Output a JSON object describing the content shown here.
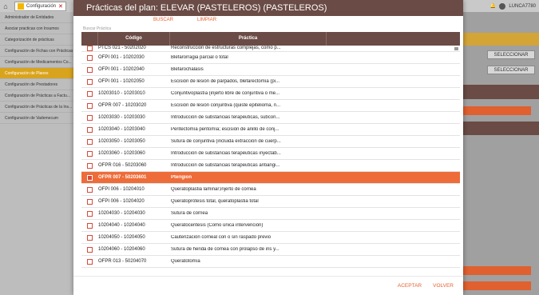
{
  "app": {
    "tab_label": "Configuración",
    "user_name": "LUNCA7780"
  },
  "sidebar": {
    "items": [
      {
        "label": "Administrador de Entidades",
        "active": false
      },
      {
        "label": "Asociar practicas con Insumos",
        "active": false
      },
      {
        "label": "Categorización de prácticas",
        "active": false
      },
      {
        "label": "Configuración de Fichas con Prácticas",
        "active": false
      },
      {
        "label": "Configuración de Medicamentos Co...",
        "active": false
      },
      {
        "label": "Configuración de Planes",
        "active": true
      },
      {
        "label": "Configuración de Prestadores",
        "active": false
      },
      {
        "label": "Configuración de Prácticas a Factu...",
        "active": false
      },
      {
        "label": "Configuración de Prácticas de la Ins...",
        "active": false
      },
      {
        "label": "Configuración de Vademecum",
        "active": false
      }
    ]
  },
  "right_pane": {
    "button1": "SELECCIONAR",
    "button2": "SELECCIONAR"
  },
  "modal": {
    "title": "Prácticas del plan: ELEVAR (PASTELEROS) (PASTELEROS)",
    "search_button": "BUSCAR",
    "clear_button": "LIMPIAR",
    "search_placeholder": "Buscar Práctica",
    "columns": {
      "code": "Código",
      "practice": "Práctica"
    },
    "rows": [
      {
        "code": "PTCS 021 - 50202020",
        "name": "Reconstrucción de estructuras complejas, como p...",
        "selected": false
      },
      {
        "code": "OFPI 001 - 10202030",
        "name": "Blefarorragia parcial o total",
        "selected": false
      },
      {
        "code": "OFPI 001 - 10202040",
        "name": "Blefarochalasis",
        "selected": false
      },
      {
        "code": "OFPI 001 - 10202050",
        "name": "Escisión de lesión de párpados, blefarectomía (pi...",
        "selected": false
      },
      {
        "code": "10203010 - 10203010",
        "name": "Conjuntivoplastía (injerto libre de conjuntiva o me...",
        "selected": false
      },
      {
        "code": "OFPR 007 - 10203020",
        "name": "Escisión de lesión conjuntiva (quiste epitelioma, n...",
        "selected": false
      },
      {
        "code": "10203030 - 10203030",
        "name": "Introducción de substancias terapéuticas, subcon...",
        "selected": false
      },
      {
        "code": "10203040 - 10203040",
        "name": "Peritectomía peritomía; escisión de anillo de conj...",
        "selected": false
      },
      {
        "code": "10203050 - 10203050",
        "name": "Sutura de conjuntiva (incluida extracción de cuerp...",
        "selected": false
      },
      {
        "code": "10203060 - 10203060",
        "name": "Introducción de substancias terapéuticas inyectab...",
        "selected": false
      },
      {
        "code": "OFPR 016 - 50203060",
        "name": "Introduccion de substancias terapeuticas antiangi...",
        "selected": false
      },
      {
        "code": "OFPR 007 - 50203601",
        "name": "Pterigion",
        "selected": true
      },
      {
        "code": "OFPI 006 - 10204010",
        "name": "Queratoplastia laminar;injerto de córnea",
        "selected": false
      },
      {
        "code": "OFPI 006 - 10204020",
        "name": "Queratoprótesis total, queratoplastia total",
        "selected": false
      },
      {
        "code": "10204030 - 10204030",
        "name": "Sutura de córnea",
        "selected": false
      },
      {
        "code": "10204040 - 10204040",
        "name": "Queratocentesis (Como única intervención)",
        "selected": false
      },
      {
        "code": "10204050 - 10204050",
        "name": "Cauterización corneal con o sin raspado previo",
        "selected": false
      },
      {
        "code": "10204060 - 10204060",
        "name": "Sutura de herida de córnea con prolapso de iris y...",
        "selected": false
      },
      {
        "code": "OFPR 013 - 50204070",
        "name": "Queratotomía",
        "selected": false
      }
    ],
    "accept_button": "ACEPTAR",
    "back_button": "VOLVER"
  }
}
